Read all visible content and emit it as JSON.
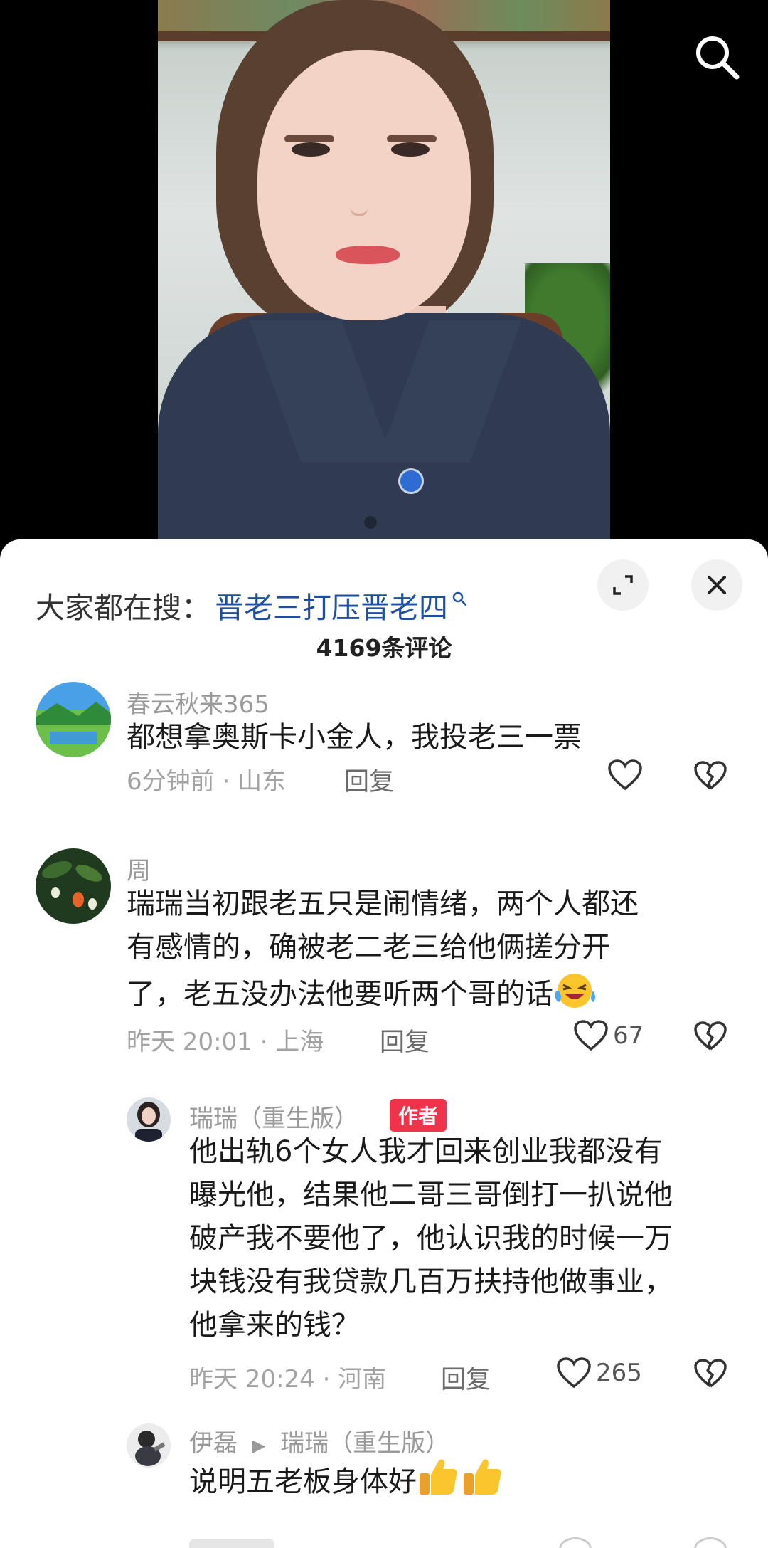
{
  "search_hint": {
    "prefix": "大家都在搜：",
    "keyword": "晋老三打压晋老四"
  },
  "comment_count_label": "4169条评论",
  "comments": [
    {
      "user": "春云秋来365",
      "text": "都想拿奥斯卡小金人，我投老三一票",
      "time": "6分钟前",
      "location": "山东",
      "reply_label": "回复",
      "likes": ""
    },
    {
      "user": "周",
      "lines": [
        "瑞瑞当初跟老五只是闹情绪，两个人都还",
        "有感情的，确被老二老三给他俩搓分开",
        "了，老五没办法他要听两个哥的话"
      ],
      "time": "昨天 20:01",
      "location": "上海",
      "reply_label": "回复",
      "likes": "67"
    },
    {
      "user": "瑞瑞（重生版）",
      "tag": "作者",
      "lines": [
        "他出轨6个女人我才回来创业我都没有",
        "曝光他，结果他二哥三哥倒打一扒说他",
        "破产我不要他了，他认识我的时候一万",
        "块钱没有我贷款几百万扶持他做事业，",
        "他拿来的钱？"
      ],
      "time": "昨天 20:24",
      "location": "河南",
      "reply_label": "回复",
      "likes": "265"
    },
    {
      "user": "伊磊",
      "reply_to": "瑞瑞（重生版）",
      "text": "说明五老板身体好"
    }
  ],
  "icons": {
    "search": "search-icon",
    "expand": "expand-icon",
    "close": "close-icon",
    "like": "heart-icon",
    "dislike": "broken-heart-icon",
    "search_small": "search-small-icon"
  },
  "colors": {
    "keyword": "#1f4fa0",
    "author_tag": "#f0334a"
  }
}
